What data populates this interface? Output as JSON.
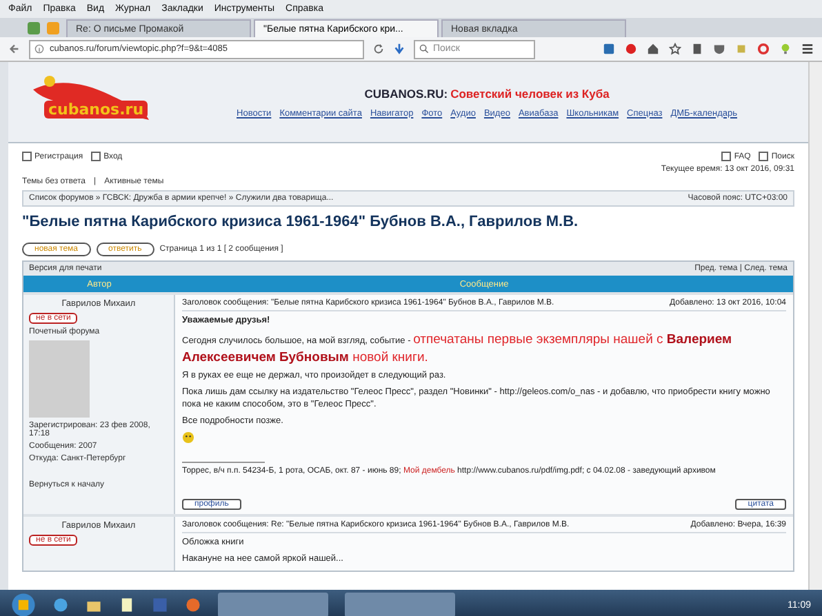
{
  "menu_bar": [
    "Файл",
    "Правка",
    "Вид",
    "Журнал",
    "Закладки",
    "Инструменты",
    "Справка"
  ],
  "tabs": [
    {
      "label": "Re: О письме Промакой",
      "selected": false
    },
    {
      "label": "\"Белые пятна Карибского кри...",
      "selected": true
    },
    {
      "label": "Новая вкладка",
      "selected": false
    }
  ],
  "address_bar": {
    "url": "cubanos.ru/forum/viewtopic.php?f=9&t=4085"
  },
  "search": {
    "placeholder": "Поиск"
  },
  "site": {
    "logo_text": "cubanos.ru",
    "title": "CUBANOS.RU:",
    "subtitle": "Советский человек из Куба",
    "nav": [
      "Новости",
      "Комментарии сайта",
      "Навигатор",
      "Фото",
      "Аудио",
      "Видео",
      "Авиабаза",
      "Школьникам",
      "Спецназ",
      "ДМБ-календарь"
    ]
  },
  "user_links": [
    "Регистрация",
    "Вход"
  ],
  "help_links": [
    "FAQ",
    "Поиск"
  ],
  "current_time": "Текущее время: 13 окт 2016, 09:31",
  "quick_links": [
    "Темы без ответа",
    "Активные темы"
  ],
  "quick_links_separator": "|",
  "breadcrumb": "Список форумов » ГСВСК: Дружба в армии крепче! » Служили два товарища...",
  "timezone": "Часовой пояс: UTC+03:00",
  "topic_title": "\"Белые пятна Карибского кризиса 1961-1964\" Бубнов В.А., Гаврилов М.В.",
  "topic_buttons": [
    "новая тема",
    "ответить"
  ],
  "pagination": "Страница 1 из 1  [ 2 сообщения ]",
  "print_link": "Версия для печати",
  "topic_nav": "Пред. тема | След. тема",
  "columns": [
    "Автор",
    "Сообщение"
  ],
  "posts": [
    {
      "author": "Гаврилов Михаил",
      "subject": "Заголовок сообщения: \"Белые пятна Карибского кризиса 1961-1964\" Бубнов В.А., Гаврилов М.В.",
      "posted": "Добавлено: 13 окт 2016, 10:04",
      "status_badge": "не в сети",
      "rank": "Почетный форума",
      "body": [
        [
          {
            "kind": "bold",
            "text": "Уважаемые друзья!"
          }
        ],
        [
          {
            "kind": "plain",
            "text": "Сегодня случилось большое, на мой взгляд, событие - "
          },
          {
            "kind": "red",
            "text": "отпечатаны первые экземпляры нашей с "
          },
          {
            "kind": "red_bold",
            "text": "Валерием Алексеевичем Бубновым"
          },
          {
            "kind": "red",
            "text": " новой книги."
          }
        ],
        [
          {
            "kind": "plain",
            "text": "Я в руках ее еще не держал, что произойдет в следующий раз."
          }
        ],
        [
          {
            "kind": "plain",
            "text": "Пока лишь дам ссылку на издательство \"Гелеос Пресс\", раздел \"Новинки\" - http://geleos.com/o_nas - и добавлю, что приобрести книгу можно пока не каким способом, это в \"Гелеос Пресс\"."
          }
        ],
        [
          {
            "kind": "plain",
            "text": "Все подробности позже."
          }
        ]
      ],
      "signature": [
        {
          "kind": "plain",
          "text": "Торрес, в/ч п.п. 54234-Б, 1 рота, ОСАБ, окт. 87 - июнь 89; "
        },
        {
          "kind": "red",
          "text": "Мой дембель"
        },
        {
          "kind": "plain",
          "text": " http://www.cubanos.ru/pdf/img.pdf; с 04.02.08 - заведующий архивом"
        }
      ],
      "joined": "Зарегистрирован: 23 фев 2008, 17:18",
      "posts_count": "Сообщения: 2007",
      "location": "Откуда: Санкт-Петербург",
      "back_link": "Вернуться к началу",
      "profile_button": "профиль",
      "quote_button": "цитата"
    },
    {
      "author": "Гаврилов Михаил",
      "subject": "Заголовок сообщения: Re: \"Белые пятна Карибского кризиса 1961-1964\" Бубнов В.А., Гаврилов М.В.",
      "posted": "Добавлено: Вчера, 16:39",
      "status_badge": "не в сети",
      "body": [
        [
          {
            "kind": "plain",
            "text": "Обложка книги"
          }
        ],
        [
          {
            "kind": "plain",
            "text": "Накануне на нее самой яркой нашей..."
          }
        ]
      ]
    }
  ],
  "taskbar": {
    "clock": "11:09"
  }
}
